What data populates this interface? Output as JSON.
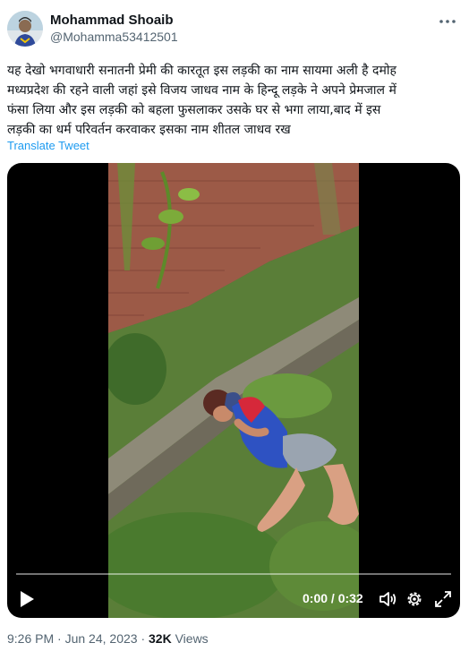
{
  "author": {
    "name": "Mohammad Shoaib",
    "handle": "@Mohamma53412501",
    "avatar_icon": "avatar-photo"
  },
  "tweet": {
    "lines": [
      "यह देखो भगवाधारी सनातनी प्रेमी की कारतूत इस लड़की का नाम सायमा अली है दमोह",
      "मध्यप्रदेश की रहने वाली जहां इसे विजय जाधव नाम के हिन्दू लड़के ने अपने प्रेमजाल में",
      "फंसा लिया और इस लड़की को बहला फुसलाकर उसके घर से भगा लाया,बाद में इस",
      "लड़की का धर्म परिवर्तन करवाकर इसका नाम शीतल जाधव रख"
    ],
    "translate_label": "Translate Tweet"
  },
  "video": {
    "time": "0:00 / 0:32",
    "progress": 0,
    "icons": [
      "play-icon",
      "volume-icon",
      "settings-icon",
      "fullscreen-icon"
    ]
  },
  "meta": {
    "time": "9:26 PM",
    "separator": "·",
    "date": "Jun 24, 2023",
    "views_count": "32K",
    "views_label": "Views"
  },
  "colors": {
    "link": "#1d9bf0",
    "secondary_text": "#536471",
    "primary_text": "#0f1419"
  }
}
